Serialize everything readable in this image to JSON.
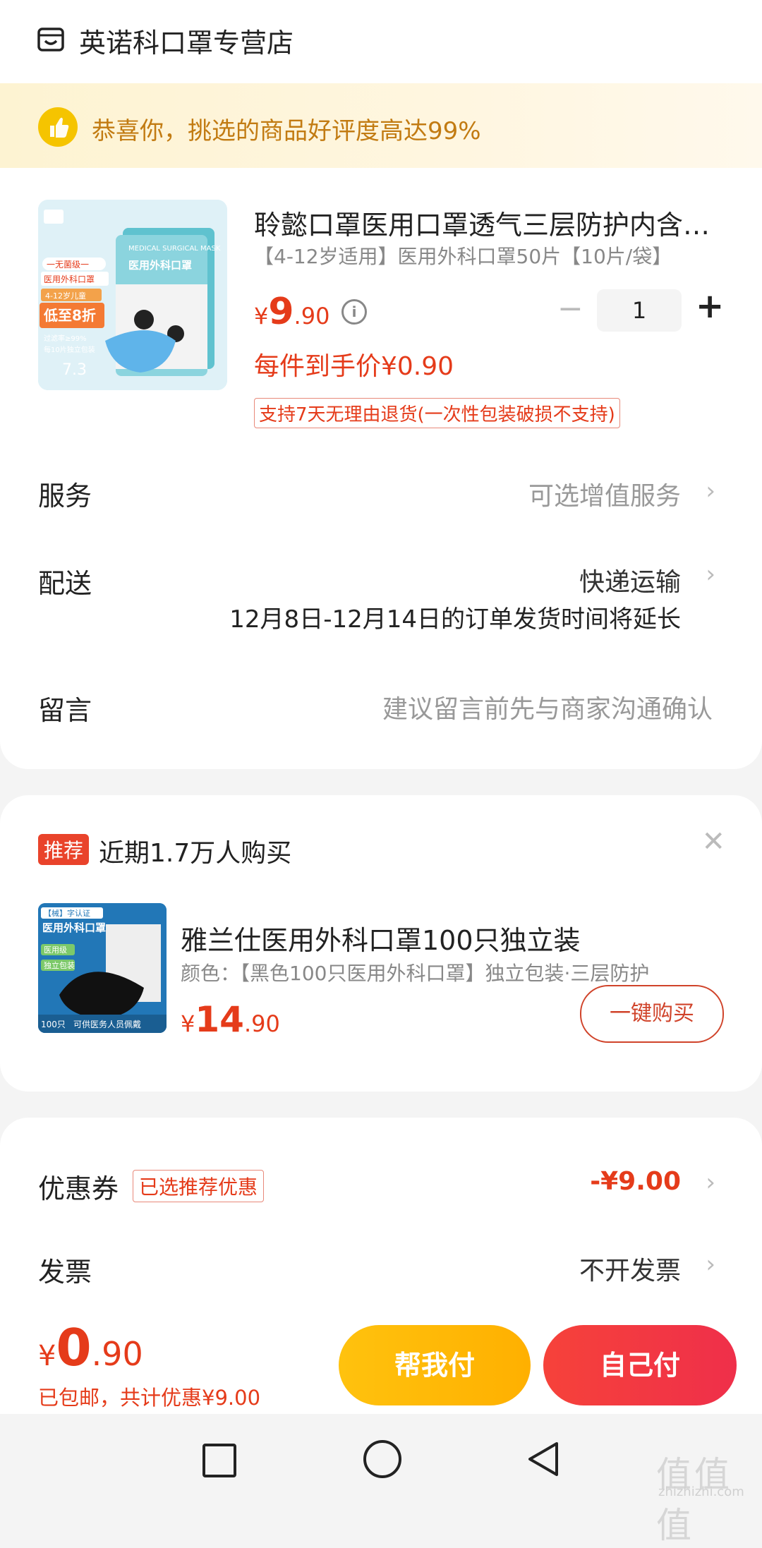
{
  "store": {
    "name": "英诺科口罩专营店",
    "icon": "store-icon"
  },
  "banner": {
    "text": "恭喜你，挑选的商品好评度高达99%",
    "icon": "thumbs-up-icon"
  },
  "product": {
    "image_text": {
      "badge1": "一无菌级一",
      "badge2": "医用外科口罩",
      "age": "4-12岁儿童",
      "discount": "低至8折",
      "filter": "过滤率≥99%",
      "pack": "每10片独立包装",
      "unit": "7.3",
      "brand_en": "MEDICAL SURGICAL MASK",
      "brand_cn": "医用外科口罩"
    },
    "title": "聆懿口罩医用口罩透气三层防护内含…",
    "spec": "【4-12岁适用】医用外科口罩50片【10片/袋】",
    "price_currency": "¥",
    "price_int": "9",
    "price_dec": ".90",
    "quantity": "1",
    "unit_price": "每件到手价¥0.90",
    "return_policy": "支持7天无理由退货(一次性包装破损不支持)"
  },
  "rows": {
    "service_label": "服务",
    "service_value": "可选增值服务",
    "delivery_label": "配送",
    "delivery_value": "快递运输",
    "delivery_note": "12月8日-12月14日的订单发货时间将延长",
    "message_label": "留言",
    "message_placeholder": "建议留言前先与商家沟通确认"
  },
  "recommend": {
    "tag": "推荐",
    "title": "近期1.7万人购买",
    "image_text": {
      "cert": "【械】字认证",
      "name": "医用外科口罩",
      "grade": "医用级",
      "pack": "独立包装",
      "count": "100只",
      "note": "可供医务人员佩戴"
    },
    "name": "雅兰仕医用外科口罩100只独立装",
    "spec": "颜色：【黑色100只医用外科口罩】独立包装·三层防护",
    "price_currency": "¥",
    "price_int": "14",
    "price_dec": ".90",
    "buy_label": "一键购买"
  },
  "coupon": {
    "label": "优惠券",
    "tag": "已选推荐优惠",
    "value": "-¥9.00"
  },
  "invoice": {
    "label": "发票",
    "value": "不开发票"
  },
  "bottom": {
    "currency": "¥",
    "total_int": "0",
    "total_dec": ".90",
    "sub": "已包邮，共计优惠¥9.00",
    "help_pay": "帮我付",
    "self_pay": "自己付"
  },
  "watermark": {
    "main": "值值值",
    "sub": "zhizhizhi.com"
  },
  "colors": {
    "accent": "#e53b1a",
    "help_button": "#ffb800",
    "self_button": "#f23c42",
    "banner_bg": "#fdf3d2",
    "banner_text": "#c27b12"
  }
}
